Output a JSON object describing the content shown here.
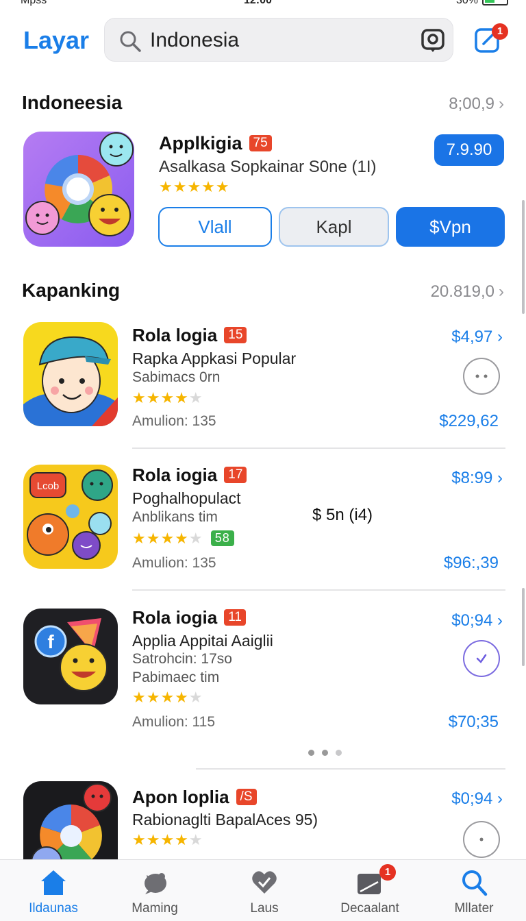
{
  "status_bar": {
    "left": "Mpss",
    "time": "12:00",
    "right": "30%"
  },
  "header": {
    "title": "Layar",
    "search_value": "Indonesia",
    "notification_count": "1"
  },
  "featured": {
    "section_title": "Indoneesia",
    "section_meta": "8;00,9",
    "app_name": "Applkigia",
    "tag": "75",
    "subtitle": "Asalkasa Sopkainar S0ne (1I)",
    "stars": "★★★★★",
    "price": "7.9.90",
    "buttons": [
      "Vlall",
      "Kapl",
      "$Vpn"
    ]
  },
  "ranking": {
    "section_title": "Kapanking",
    "section_meta": "20.819,0",
    "items": [
      {
        "name": "Rola logia",
        "tag": "15",
        "line1": "Rapka Appkasi Popular",
        "line2": "Sabimacs 0rn",
        "line3": "",
        "amount": "Amulion: 135",
        "price": "$4,97",
        "price2": "$229,62"
      },
      {
        "name": "Rola iogia",
        "tag": "17",
        "line1": "Poghalhopulact",
        "line2": "Anblikans tim",
        "line3": "",
        "extra_tag": "58",
        "mid_price": "$ 5n (i4)",
        "amount": "Amulion: 135",
        "price": "$8:99",
        "price2": "$96:,39"
      },
      {
        "name": "Rola iogia",
        "tag": "11",
        "line1": "Applia Appitai Aaiglii",
        "line2": "Satrohcin: 17so",
        "line3": "Pabimaec tim",
        "amount": "Amulion: 115",
        "price": "$0;94",
        "price2": "$70;35"
      },
      {
        "name": "Apon loplia",
        "tag": "/S",
        "line1": "Rabionaglti BapalAces 95)",
        "line2": "",
        "line3": "",
        "amount": "",
        "price": "$0;94",
        "price2": ""
      }
    ]
  },
  "tabbar": {
    "tabs": [
      {
        "label": "Ildaunas",
        "icon": "home-icon"
      },
      {
        "label": "Maming",
        "icon": "games-icon"
      },
      {
        "label": "Laus",
        "icon": "heart-icon"
      },
      {
        "label": "Decaalant",
        "icon": "updates-icon",
        "badge": "1"
      },
      {
        "label": "Mllater",
        "icon": "search-icon"
      }
    ]
  },
  "colors": {
    "accent": "#1a7ee8",
    "badge": "#e53222",
    "tag": "#e8462a",
    "star": "#f6b500"
  }
}
